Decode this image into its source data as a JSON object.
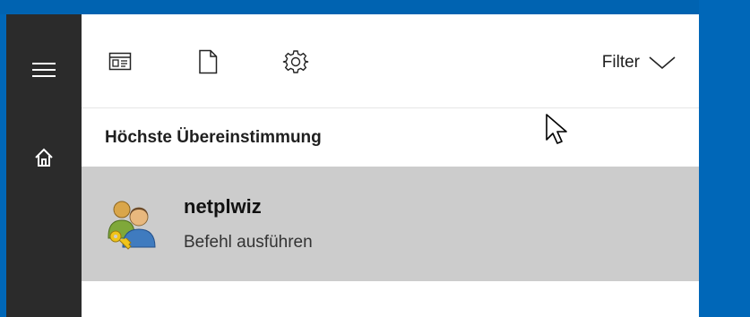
{
  "toolbar": {
    "icons": [
      "apps-icon",
      "document-icon",
      "settings-icon"
    ],
    "filter_label": "Filter"
  },
  "results": {
    "section_title": "Höchste Übereinstimmung",
    "top_match": {
      "title": "netplwiz",
      "subtitle": "Befehl ausführen",
      "icon": "users-key-icon"
    }
  },
  "colors": {
    "rail": "#2b2b2b",
    "desktop": "#0067b8",
    "selected_row": "#cccccc",
    "panel": "#ffffff"
  }
}
